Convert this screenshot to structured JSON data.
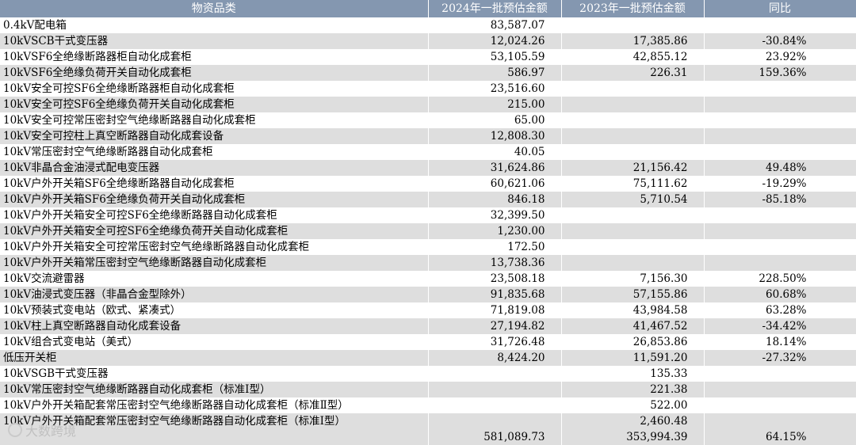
{
  "headers": [
    "物资品类",
    "2024年一批预估金额",
    "2023年一批预估金额",
    "同比"
  ],
  "rows": [
    {
      "name": "0.4kV配电箱",
      "v2024": "83,587.07",
      "v2023": "",
      "yoy": ""
    },
    {
      "name": "10kVSCB干式变压器",
      "v2024": "12,024.26",
      "v2023": "17,385.86",
      "yoy": "-30.84%"
    },
    {
      "name": "10kVSF6全绝缘断路器柜自动化成套柜",
      "v2024": "53,105.59",
      "v2023": "42,855.12",
      "yoy": "23.92%"
    },
    {
      "name": "10kVSF6全绝缘负荷开关自动化成套柜",
      "v2024": "586.97",
      "v2023": "226.31",
      "yoy": "159.36%"
    },
    {
      "name": "10kV安全可控SF6全绝缘断路器柜自动化成套柜",
      "v2024": "23,516.60",
      "v2023": "",
      "yoy": ""
    },
    {
      "name": "10kV安全可控SF6全绝缘负荷开关自动化成套柜",
      "v2024": "215.00",
      "v2023": "",
      "yoy": ""
    },
    {
      "name": "10kV安全可控常压密封空气绝缘断路器自动化成套柜",
      "v2024": "65.00",
      "v2023": "",
      "yoy": ""
    },
    {
      "name": "10kV安全可控柱上真空断路器自动化成套设备",
      "v2024": "12,808.30",
      "v2023": "",
      "yoy": ""
    },
    {
      "name": "10kV常压密封空气绝缘断路器自动化成套柜",
      "v2024": "40.05",
      "v2023": "",
      "yoy": ""
    },
    {
      "name": "10kV非晶合金油浸式配电变压器",
      "v2024": "31,624.86",
      "v2023": "21,156.42",
      "yoy": "49.48%"
    },
    {
      "name": "10kV户外开关箱SF6全绝缘断路器自动化成套柜",
      "v2024": "60,621.06",
      "v2023": "75,111.62",
      "yoy": "-19.29%"
    },
    {
      "name": "10kV户外开关箱SF6全绝缘负荷开关自动化成套柜",
      "v2024": "846.18",
      "v2023": "5,710.54",
      "yoy": "-85.18%"
    },
    {
      "name": "10kV户外开关箱安全可控SF6全绝缘断路器自动化成套柜",
      "v2024": "32,399.50",
      "v2023": "",
      "yoy": ""
    },
    {
      "name": "10kV户外开关箱安全可控SF6全绝缘负荷开关自动化成套柜",
      "v2024": "1,230.00",
      "v2023": "",
      "yoy": ""
    },
    {
      "name": "10kV户外开关箱安全可控常压密封空气绝缘断路器自动化成套柜",
      "v2024": "172.50",
      "v2023": "",
      "yoy": ""
    },
    {
      "name": "10kV户外开关箱常压密封空气绝缘断路器自动化成套柜",
      "v2024": "13,738.36",
      "v2023": "",
      "yoy": ""
    },
    {
      "name": "10kV交流避雷器",
      "v2024": "23,508.18",
      "v2023": "7,156.30",
      "yoy": "228.50%"
    },
    {
      "name": "10kV油浸式变压器（非晶合金型除外）",
      "v2024": "91,835.68",
      "v2023": "57,155.86",
      "yoy": "60.68%"
    },
    {
      "name": "10kV预装式变电站（欧式、紧凑式）",
      "v2024": "71,819.08",
      "v2023": "43,984.58",
      "yoy": "63.28%"
    },
    {
      "name": "10kV柱上真空断路器自动化成套设备",
      "v2024": "27,194.82",
      "v2023": "41,467.52",
      "yoy": "-34.42%"
    },
    {
      "name": "10kV组合式变电站（美式）",
      "v2024": "31,726.48",
      "v2023": "26,853.86",
      "yoy": "18.14%"
    },
    {
      "name": "低压开关柜",
      "v2024": "8,424.20",
      "v2023": "11,591.20",
      "yoy": "-27.32%"
    },
    {
      "name": "10kVSGB干式变压器",
      "v2024": "",
      "v2023": "135.33",
      "yoy": ""
    },
    {
      "name": "10kV常压密封空气绝缘断路器自动化成套柜（标准Ⅰ型）",
      "v2024": "",
      "v2023": "221.38",
      "yoy": ""
    },
    {
      "name": "10kV户外开关箱配套常压密封空气绝缘断路器自动化成套柜（标准Ⅱ型）",
      "v2024": "",
      "v2023": "522.00",
      "yoy": ""
    },
    {
      "name": "10kV户外开关箱配套常压密封空气绝缘断路器自动化成套柜（标准Ⅰ型）",
      "v2024": "",
      "v2023": "2,460.48",
      "yoy": ""
    }
  ],
  "total": {
    "name": "",
    "v2024": "581,089.73",
    "v2023": "353,994.39",
    "yoy": "64.15%"
  },
  "watermark": "大数跨境"
}
